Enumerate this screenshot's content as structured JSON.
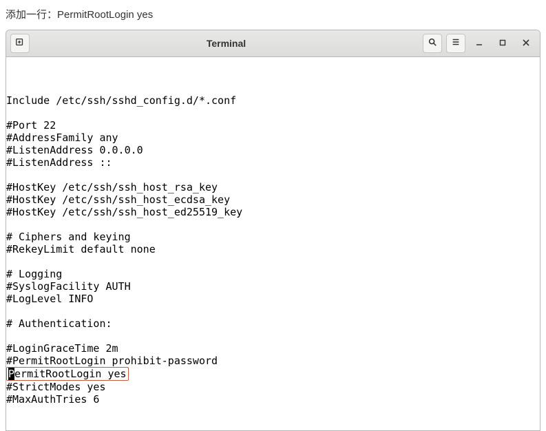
{
  "instruction": "添加一行：PermitRootLogin yes",
  "window": {
    "title": "Terminal"
  },
  "icons": {
    "newtab": "new-tab-icon",
    "search": "search-icon",
    "menu": "hamburger-icon",
    "min": "minimize-icon",
    "max": "maximize-icon",
    "close": "close-icon"
  },
  "terminal": {
    "lines_before": "Include /etc/ssh/sshd_config.d/*.conf\n\n#Port 22\n#AddressFamily any\n#ListenAddress 0.0.0.0\n#ListenAddress ::\n\n#HostKey /etc/ssh/ssh_host_rsa_key\n#HostKey /etc/ssh/ssh_host_ecdsa_key\n#HostKey /etc/ssh/ssh_host_ed25519_key\n\n# Ciphers and keying\n#RekeyLimit default none\n\n# Logging\n#SyslogFacility AUTH\n#LogLevel INFO\n\n# Authentication:\n\n#LoginGraceTime 2m\n#PermitRootLogin prohibit-password",
    "highlight_cursor": "P",
    "highlight_rest": "ermitRootLogin yes",
    "lines_after": "#StrictModes yes\n#MaxAuthTries 6"
  }
}
